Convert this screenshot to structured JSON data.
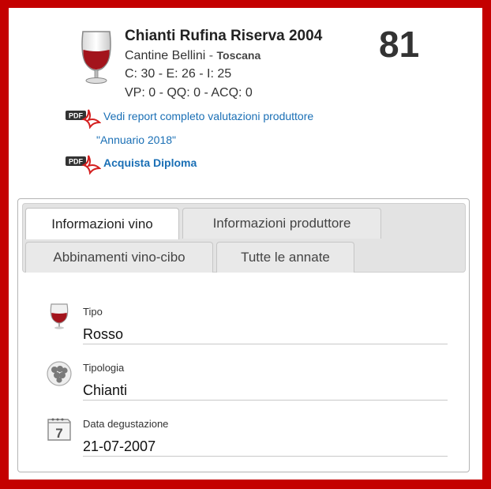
{
  "wine": {
    "name": "Chianti Rufina Riserva 2004",
    "producer": "Cantine Bellini",
    "separator": " - ",
    "region": "Toscana",
    "scores_line": "C: 30 - E: 26 - I: 25",
    "scores_line2": "VP: 0 - QQ: 0 - ACQ: 0",
    "rating": "81"
  },
  "links": {
    "report": "Vedi report completo valutazioni produttore",
    "annuario": "\"Annuario 2018\"",
    "diploma": "Acquista Diploma",
    "pdf_icon_text": "PDF"
  },
  "tabs": [
    {
      "label": "Informazioni vino",
      "active": true
    },
    {
      "label": "Informazioni produttore",
      "active": false
    },
    {
      "label": "Abbinamenti vino-cibo",
      "active": false
    },
    {
      "label": "Tutte le annate",
      "active": false
    }
  ],
  "fields": [
    {
      "label": "Tipo",
      "value": "Rosso",
      "icon": "wine-glass-icon"
    },
    {
      "label": "Tipologia",
      "value": "Chianti",
      "icon": "grapes-icon"
    },
    {
      "label": "Data degustazione",
      "value": "21-07-2007",
      "icon": "calendar-icon"
    }
  ],
  "calendar_icon_day": "7",
  "colors": {
    "frame": "#c40000",
    "wine": "#a3141c",
    "link": "#1a6fb5"
  }
}
